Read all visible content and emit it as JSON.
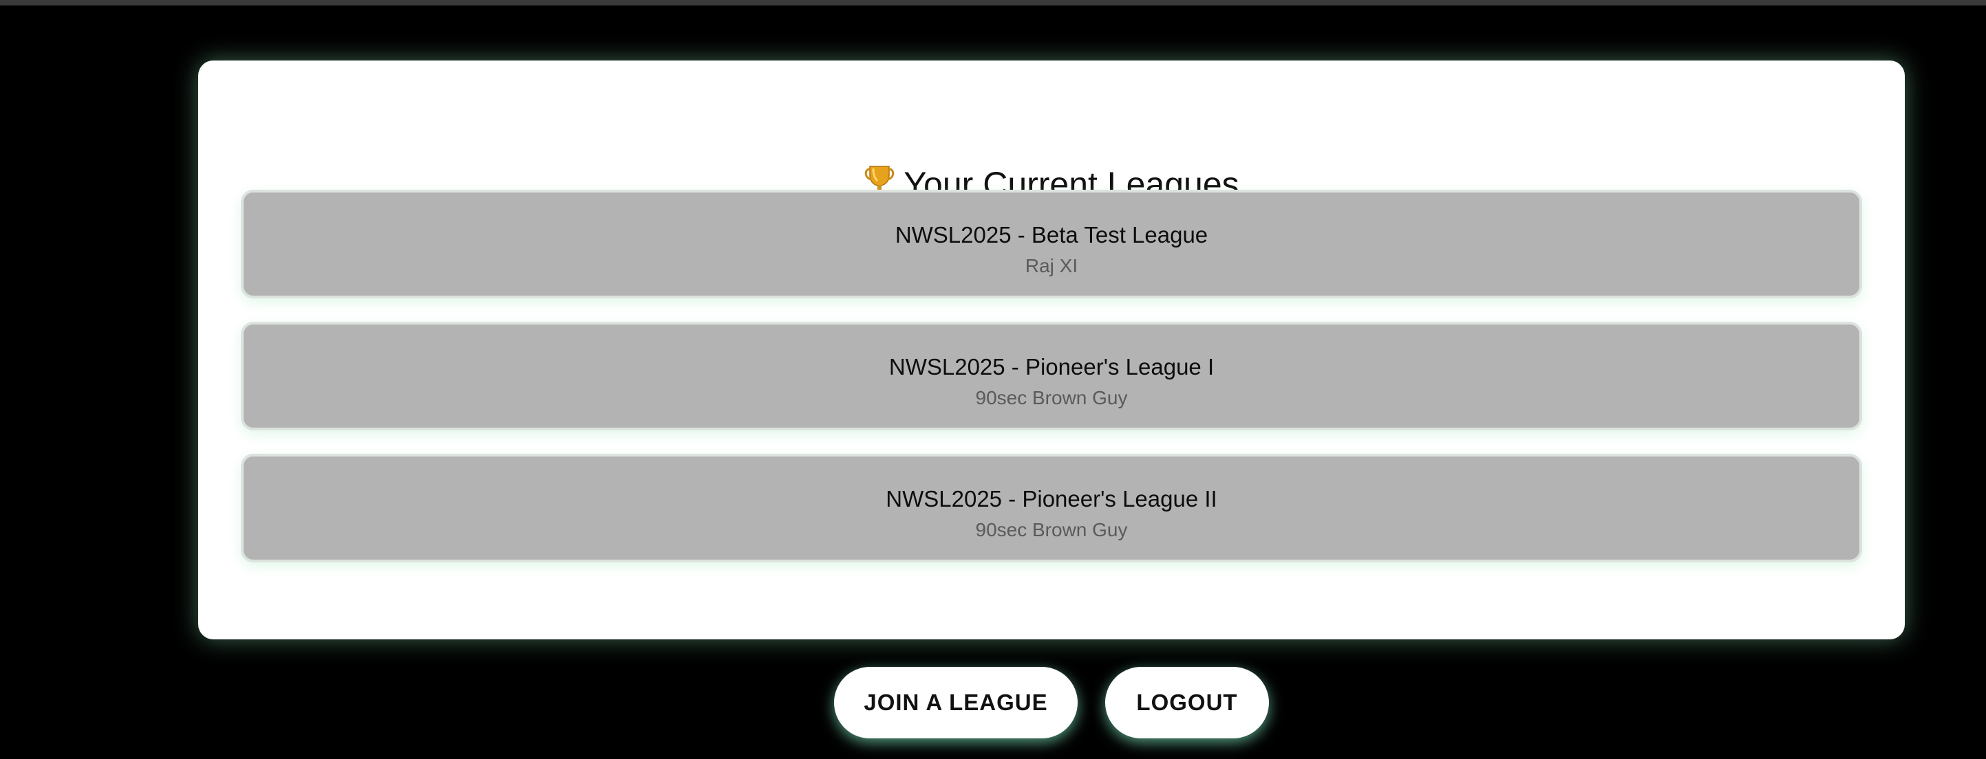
{
  "header": {
    "icon": "trophy-icon",
    "title": "Your Current Leagues"
  },
  "leagues": [
    {
      "name": "NWSL2025 - Beta Test League",
      "team": "Raj XI"
    },
    {
      "name": "NWSL2025 - Pioneer's League I",
      "team": "90sec Brown Guy"
    },
    {
      "name": "NWSL2025 - Pioneer's League II",
      "team": "90sec Brown Guy"
    }
  ],
  "actions": {
    "join_label": "JOIN A LEAGUE",
    "logout_label": "LOGOUT"
  },
  "colors": {
    "background": "#000000",
    "card": "#ffffff",
    "league_item": "#b3b3b3",
    "glow": "#82dcaa"
  }
}
